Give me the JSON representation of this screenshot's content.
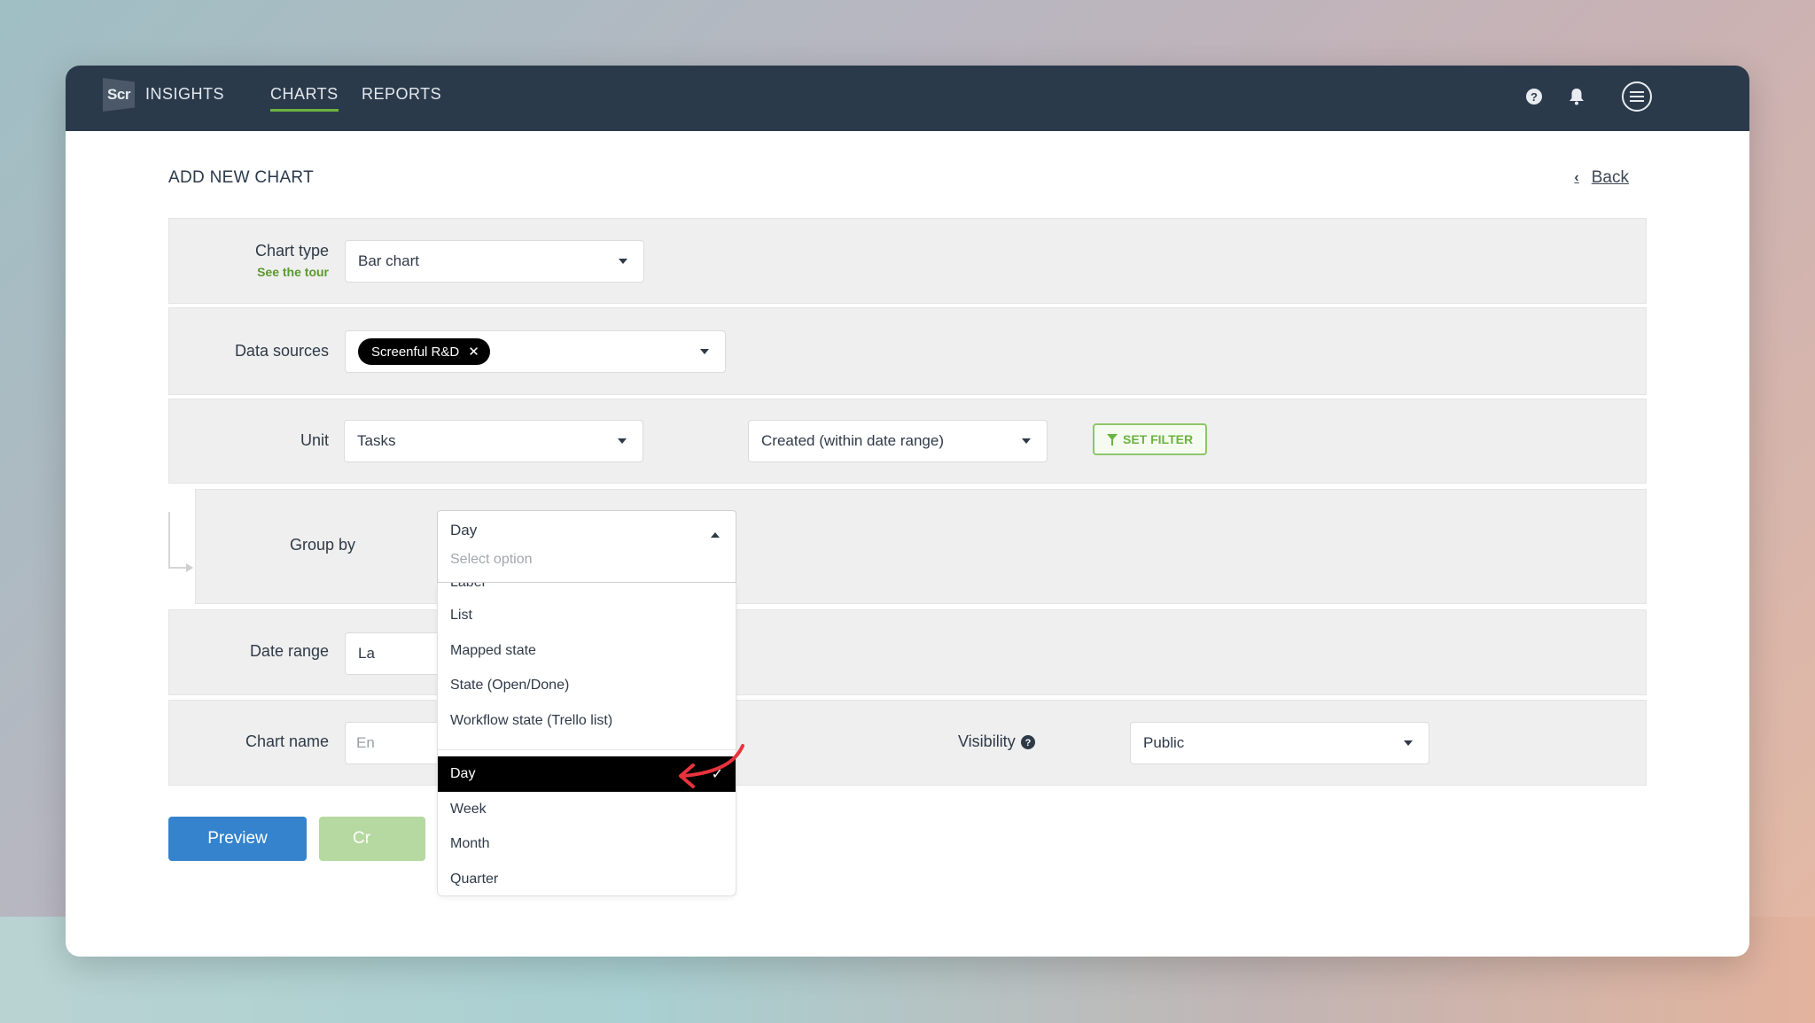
{
  "navbar": {
    "logo_text": "Scr",
    "items": [
      {
        "label": "INSIGHTS",
        "active": false
      },
      {
        "label": "CHARTS",
        "active": true
      },
      {
        "label": "REPORTS",
        "active": false
      }
    ],
    "icons": [
      "help-icon",
      "bell-icon",
      "menu-icon"
    ],
    "accent_color": "#6bb33f",
    "bg_color": "#2b3a4b"
  },
  "page": {
    "title": "ADD NEW CHART",
    "back_label": "Back"
  },
  "form": {
    "chart_type": {
      "label": "Chart type",
      "tour_link": "See the tour",
      "value": "Bar chart"
    },
    "data_sources": {
      "label": "Data sources",
      "tags": [
        "Screenful R&D"
      ]
    },
    "unit": {
      "label": "Unit",
      "value": "Tasks",
      "metric_value": "Created (within date range)",
      "filter_button": "SET FILTER"
    },
    "group_by": {
      "label": "Group by",
      "value": "Day",
      "placeholder": "Select option",
      "options_group_1": [
        "Label",
        "List",
        "Mapped state",
        "State (Open/Done)",
        "Workflow state (Trello list)"
      ],
      "options_group_2": [
        "Day",
        "Week",
        "Month",
        "Quarter"
      ],
      "selected": "Day"
    },
    "date_range": {
      "label": "Date range",
      "value_partial": "La"
    },
    "chart_name": {
      "label": "Chart name",
      "placeholder_partial": "En"
    },
    "visibility": {
      "label": "Visibility",
      "value": "Public"
    }
  },
  "actions": {
    "preview_label": "Preview",
    "create_label_partial": "Cr"
  }
}
